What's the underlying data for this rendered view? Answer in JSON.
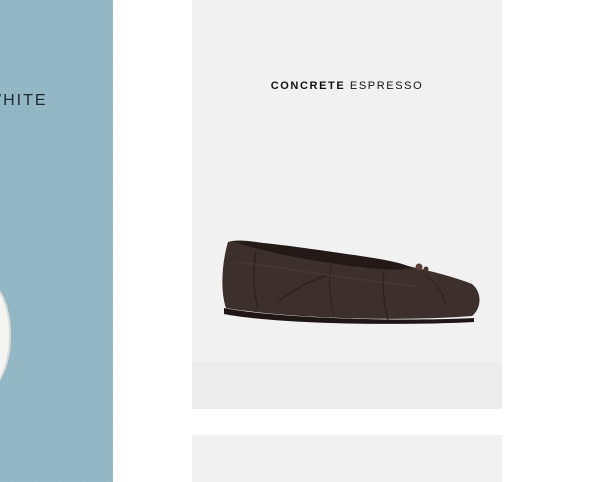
{
  "carousel": {
    "prev_card": {
      "title": "WHITE",
      "background_color": "#8fb5c3"
    },
    "main_card": {
      "title_bold": "CONCRETE",
      "title_color": "ESPRESSO",
      "background_color": "#f1f1f1",
      "product_color": "#3d2f2c"
    },
    "next_card": {
      "background_color": "#f1f1f1"
    }
  }
}
